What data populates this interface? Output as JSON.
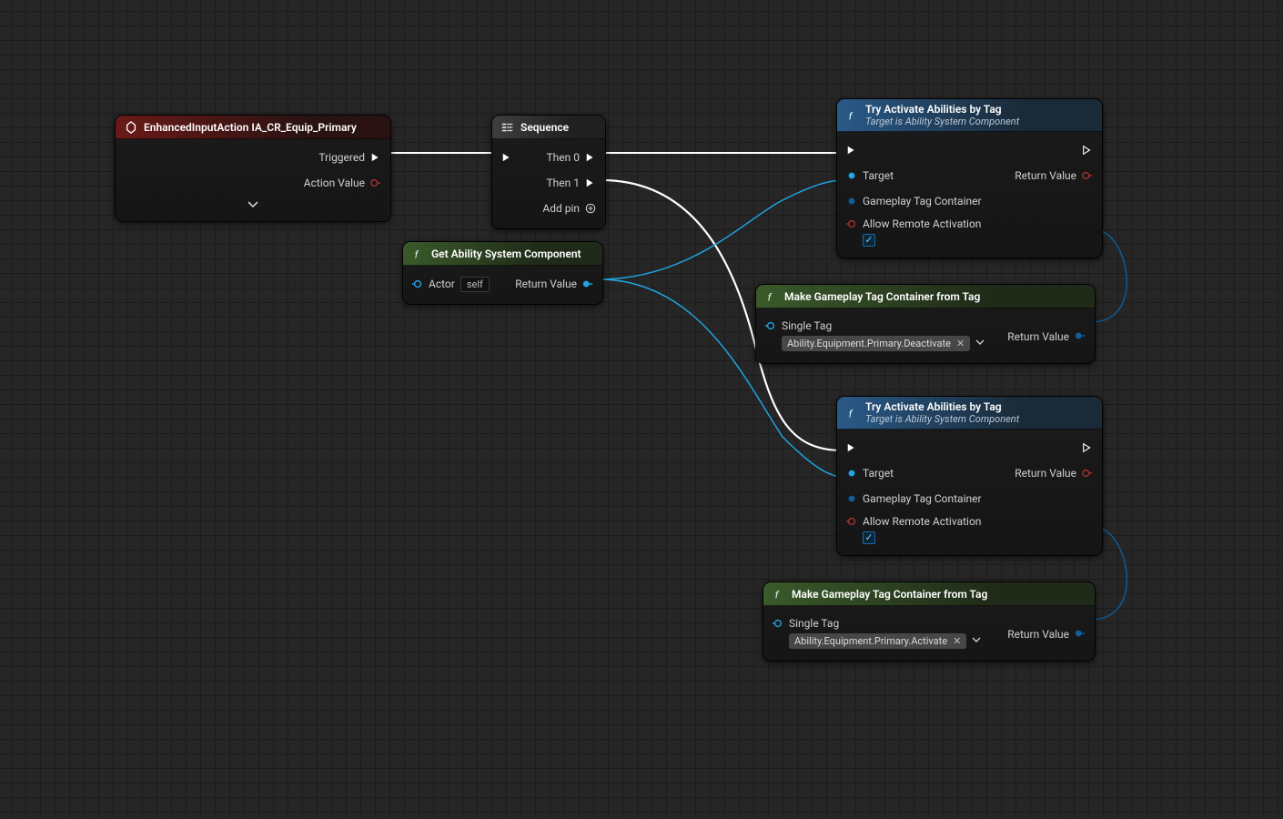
{
  "nodes": {
    "input": {
      "title": "EnhancedInputAction IA_CR_Equip_Primary",
      "pins": {
        "triggered": "Triggered",
        "actionValue": "Action Value"
      }
    },
    "sequence": {
      "title": "Sequence",
      "pins": {
        "then0": "Then 0",
        "then1": "Then 1",
        "addPin": "Add pin"
      }
    },
    "getAsc": {
      "title": "Get Ability System Component",
      "pins": {
        "actor": "Actor",
        "actorValue": "self",
        "returnValue": "Return Value"
      }
    },
    "try1": {
      "title": "Try Activate Abilities by Tag",
      "subtitle": "Target is Ability System Component",
      "pins": {
        "target": "Target",
        "tagContainer": "Gameplay Tag Container",
        "allowRemote": "Allow Remote Activation",
        "returnValue": "Return Value",
        "allowRemoteChecked": true
      }
    },
    "make1": {
      "title": "Make Gameplay Tag Container from Tag",
      "pins": {
        "singleTag": "Single Tag",
        "tagValue": "Ability.Equipment.Primary.Deactivate",
        "returnValue": "Return Value"
      }
    },
    "try2": {
      "title": "Try Activate Abilities by Tag",
      "subtitle": "Target is Ability System Component",
      "pins": {
        "target": "Target",
        "tagContainer": "Gameplay Tag Container",
        "allowRemote": "Allow Remote Activation",
        "returnValue": "Return Value",
        "allowRemoteChecked": true
      }
    },
    "make2": {
      "title": "Make Gameplay Tag Container from Tag",
      "pins": {
        "singleTag": "Single Tag",
        "tagValue": "Ability.Equipment.Primary.Activate",
        "returnValue": "Return Value"
      }
    }
  }
}
